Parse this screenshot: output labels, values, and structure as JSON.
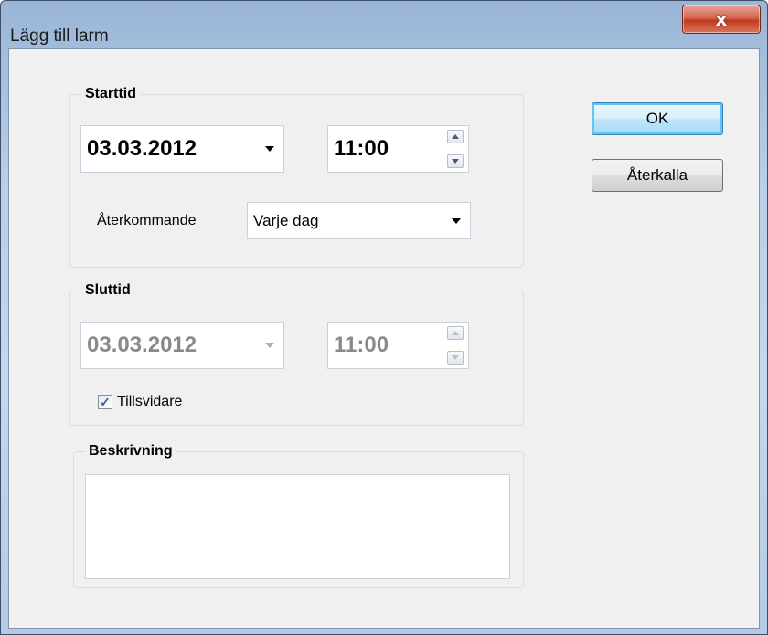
{
  "window": {
    "title": "Lägg till larm",
    "close_icon": "close-icon"
  },
  "start": {
    "title": "Starttid",
    "date": "03.03.2012",
    "time": "11:00",
    "recurring_label": "Återkommande",
    "recurring_value": "Varje dag"
  },
  "end": {
    "title": "Sluttid",
    "date": "03.03.2012",
    "time": "11:00",
    "until_further_label": "Tillsvidare",
    "until_further_checked": true
  },
  "description": {
    "title": "Beskrivning",
    "value": ""
  },
  "buttons": {
    "ok": "OK",
    "cancel": "Återkalla"
  }
}
